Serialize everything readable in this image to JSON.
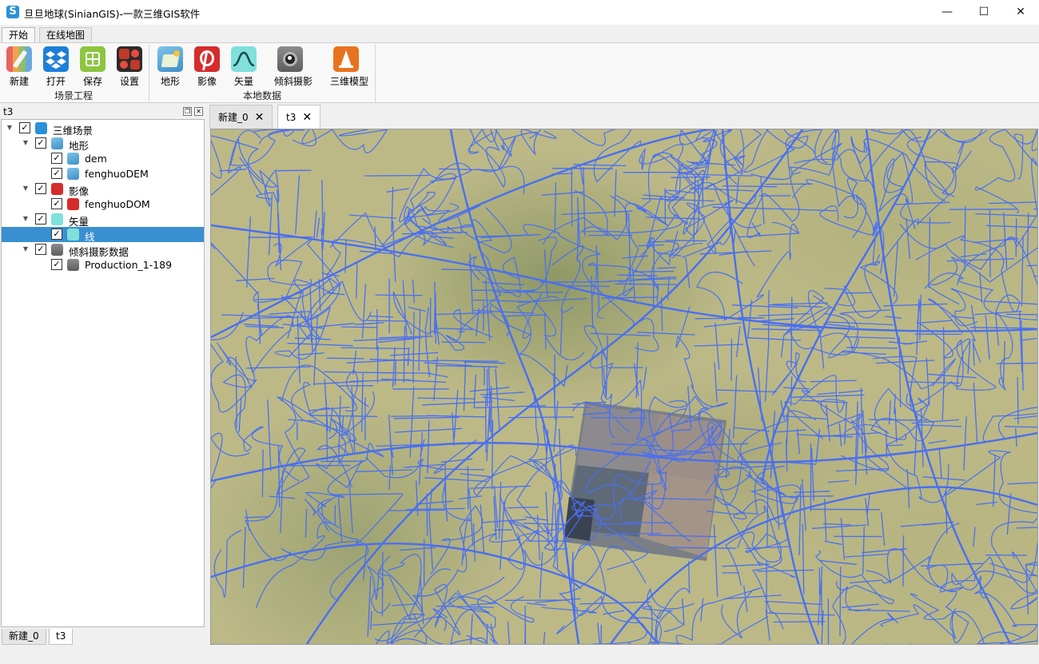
{
  "window": {
    "title": "旦旦地球(SinianGIS)-一款三维GIS软件",
    "app_icon": "S",
    "controls": [
      "—",
      "☐",
      "✕"
    ]
  },
  "ribbon": {
    "tabs": [
      {
        "label": "开始",
        "active": true
      },
      {
        "label": "在线地图",
        "active": false
      }
    ],
    "groups": [
      {
        "label": "场景工程",
        "buttons": [
          {
            "label": "新建",
            "icon": "new-scene-icon"
          },
          {
            "label": "打开",
            "icon": "open-dropbox-icon"
          },
          {
            "label": "保存",
            "icon": "save-grid-icon"
          },
          {
            "label": "设置",
            "icon": "settings-puzzle-icon"
          }
        ]
      },
      {
        "label": "本地数据",
        "buttons": [
          {
            "label": "地形",
            "icon": "terrain-icon"
          },
          {
            "label": "影像",
            "icon": "imagery-pinterest-icon"
          },
          {
            "label": "矢量",
            "icon": "vector-wave-icon"
          },
          {
            "label": "倾斜摄影",
            "icon": "oblique-camera-icon"
          },
          {
            "label": "三维模型",
            "icon": "3d-model-cone-icon"
          }
        ]
      }
    ]
  },
  "left_panel": {
    "title": "t3",
    "tree": [
      {
        "label": "三维场景",
        "level": 0,
        "expanded": true,
        "checked": true,
        "icon": "scene-s-icon",
        "selected": false
      },
      {
        "label": "地形",
        "level": 1,
        "expanded": true,
        "checked": true,
        "icon": "terrain-icon",
        "selected": false
      },
      {
        "label": "dem",
        "level": 2,
        "checked": true,
        "icon": "terrain-icon",
        "selected": false
      },
      {
        "label": "fenghuoDEM",
        "level": 2,
        "checked": true,
        "icon": "terrain-icon",
        "selected": false
      },
      {
        "label": "影像",
        "level": 1,
        "expanded": true,
        "checked": true,
        "icon": "imagery-pinterest-icon",
        "selected": false
      },
      {
        "label": "fenghuoDOM",
        "level": 2,
        "checked": true,
        "icon": "imagery-pinterest-icon",
        "selected": false
      },
      {
        "label": "矢量",
        "level": 1,
        "expanded": true,
        "checked": true,
        "icon": "vector-wave-icon",
        "selected": false
      },
      {
        "label": "线",
        "level": 2,
        "checked": true,
        "icon": "vector-wave-icon",
        "selected": true
      },
      {
        "label": "倾斜摄影数据",
        "level": 1,
        "expanded": true,
        "checked": true,
        "icon": "oblique-camera-icon",
        "selected": false
      },
      {
        "label": "Production_1-189",
        "level": 2,
        "checked": true,
        "icon": "oblique-camera-icon",
        "selected": false
      }
    ],
    "bottom_tabs": [
      {
        "label": "新建_0",
        "active": false
      },
      {
        "label": "t3",
        "active": true
      }
    ]
  },
  "doc_tabs": [
    {
      "label": "新建_0",
      "close": "✕",
      "active": false
    },
    {
      "label": "t3",
      "close": "✕",
      "active": true
    }
  ],
  "colors": {
    "road": "#4a6ff0",
    "terrain": "#bcb987",
    "selection": "#3a8fd0"
  }
}
